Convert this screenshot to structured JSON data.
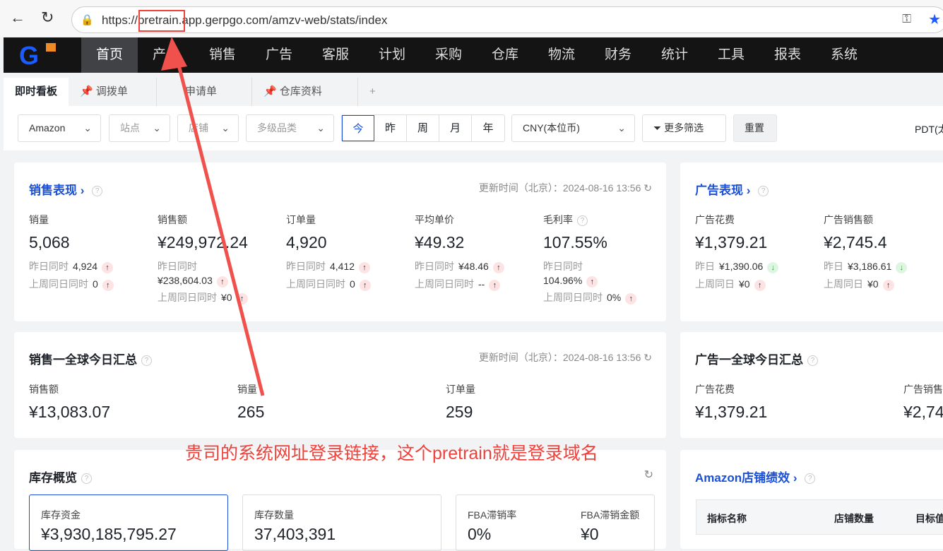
{
  "browser": {
    "url": "https://pretrain.app.gerpgo.com/amzv-web/stats/index"
  },
  "nav": {
    "logo": "G",
    "items": [
      "首页",
      "产品",
      "销售",
      "广告",
      "客服",
      "计划",
      "采购",
      "仓库",
      "物流",
      "财务",
      "统计",
      "工具",
      "报表",
      "系统"
    ]
  },
  "tabs": [
    "即时看板",
    "调拨单",
    "申请单",
    "仓库资料",
    "+"
  ],
  "filters": {
    "platform": "Amazon",
    "site": "站点",
    "shop": "店铺",
    "category": "多级品类",
    "periods": [
      "今",
      "昨",
      "周",
      "月",
      "年"
    ],
    "currency": "CNY(本位币)",
    "more": "更多筛选",
    "reset": "重置",
    "timezone": "PDT(太"
  },
  "sales": {
    "title": "销售表现",
    "update": "更新时间（北京）：2024-08-16 13:56",
    "metrics": [
      {
        "label": "销量",
        "value": "5,068",
        "y_label": "昨日同时",
        "y_val": "4,924",
        "w_label": "上周同日同时",
        "w_val": "0"
      },
      {
        "label": "销售额",
        "value": "¥249,972.24",
        "y_label": "昨日同时",
        "y_val": "¥238,604.03",
        "w_label": "上周同日同时",
        "w_val": "¥0"
      },
      {
        "label": "订单量",
        "value": "4,920",
        "y_label": "昨日同时",
        "y_val": "4,412",
        "w_label": "上周同日同时",
        "w_val": "0"
      },
      {
        "label": "平均单价",
        "value": "¥49.32",
        "y_label": "昨日同时",
        "y_val": "¥48.46",
        "w_label": "上周同日同时",
        "w_val": "--"
      },
      {
        "label": "毛利率",
        "value": "107.55%",
        "y_label": "昨日同时",
        "y_val": "104.96%",
        "w_label": "上周同日同时",
        "w_val": "0%"
      }
    ]
  },
  "ads": {
    "title": "广告表现",
    "metrics": [
      {
        "label": "广告花费",
        "value": "¥1,379.21",
        "y_label": "昨日",
        "y_val": "¥1,390.06",
        "w_label": "上周同日",
        "w_val": "¥0"
      },
      {
        "label": "广告销售额",
        "value": "¥2,745.4",
        "y_label": "昨日",
        "y_val": "¥3,186.61",
        "w_label": "上周同日",
        "w_val": "¥0"
      }
    ]
  },
  "global_sales": {
    "title": "销售一全球今日汇总",
    "update": "更新时间（北京）：2024-08-16 13:56",
    "metrics": [
      {
        "label": "销售额",
        "value": "¥13,083.07"
      },
      {
        "label": "销量",
        "value": "265"
      },
      {
        "label": "订单量",
        "value": "259"
      }
    ]
  },
  "global_ads": {
    "title": "广告一全球今日汇总",
    "metrics": [
      {
        "label": "广告花费",
        "value": "¥1,379.21"
      },
      {
        "label": "广告销售",
        "value": "¥2,74"
      }
    ]
  },
  "inventory": {
    "title": "库存概览",
    "boxes": [
      {
        "label": "库存资金",
        "value": "¥3,930,185,795.27"
      },
      {
        "label": "库存数量",
        "value": "37,403,391"
      },
      {
        "label": "FBA滞销率",
        "value": "0%"
      },
      {
        "label": "FBA滞销金额",
        "value": "¥0"
      }
    ]
  },
  "shop_perf": {
    "title": "Amazon店铺绩效",
    "columns": [
      "指标名称",
      "店铺数量",
      "目标值"
    ]
  },
  "annotation": {
    "text": "贵司的系统网址登录链接，这个pretrain就是登录域名"
  }
}
